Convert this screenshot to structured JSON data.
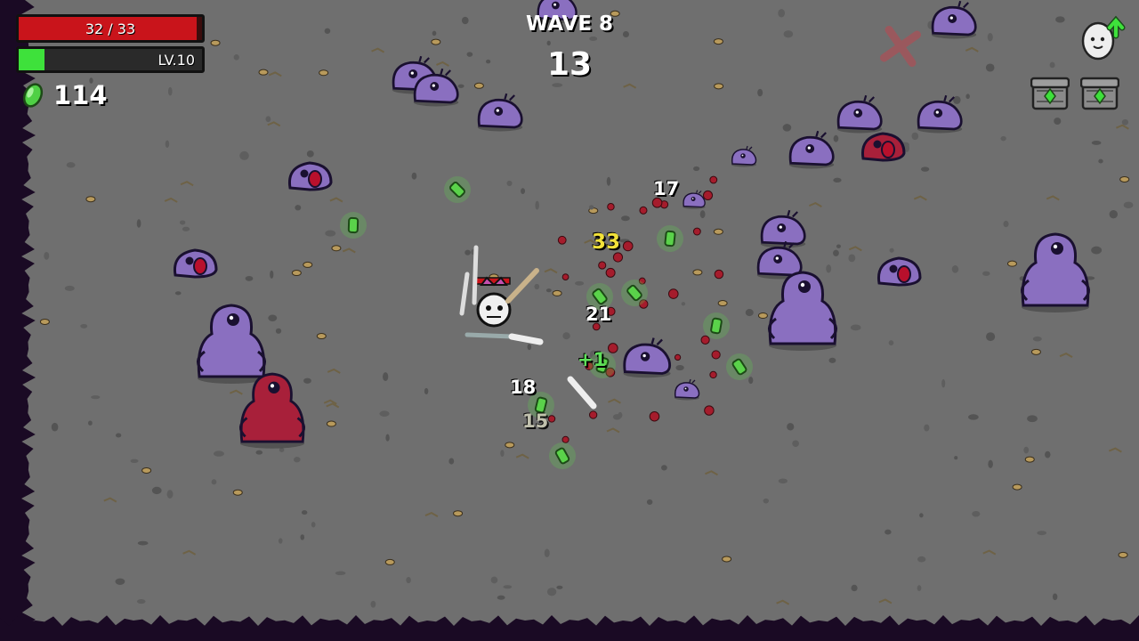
{
  "hud": {
    "hp_text": "32 / 33",
    "hp_current": 32,
    "hp_max": 33,
    "level_text": "LV.10",
    "xp_fraction": 0.14,
    "materials": "114",
    "wave_label": "WAVE 8",
    "wave_timer": "13",
    "pending_crates": 2,
    "pending_levelup": true
  },
  "floating_numbers": [
    {
      "text": "17",
      "kind": "normal"
    },
    {
      "text": "33",
      "kind": "crit"
    },
    {
      "text": "21",
      "kind": "normal"
    },
    {
      "text": "+1",
      "kind": "pickup"
    },
    {
      "text": "18",
      "kind": "normal"
    },
    {
      "text": "15",
      "kind": "faded"
    }
  ],
  "colors": {
    "ground": "#6f6f6f",
    "enemy": "#8a6fc0",
    "enemy_hurt": "#a8203a",
    "material": "#5ad24a",
    "hp": "#c9141b",
    "xp": "#3ee13b",
    "void": "#1a0a24"
  },
  "icons": [
    "material-icon",
    "levelup-egg-icon",
    "loot-crate-icon",
    "danger-cross-icon"
  ]
}
